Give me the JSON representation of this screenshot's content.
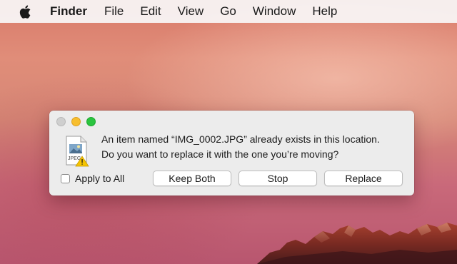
{
  "menubar": {
    "app_name": "Finder",
    "items": [
      "File",
      "Edit",
      "View",
      "Go",
      "Window",
      "Help"
    ]
  },
  "dialog": {
    "file_badge": "JPEG",
    "message_line1": "An item named “IMG_0002.JPG” already exists in this location.",
    "message_line2": "Do you want to replace it with the one you’re moving?",
    "checkbox_label": "Apply to All",
    "checkbox_checked": false,
    "buttons": {
      "keep_both": "Keep Both",
      "stop": "Stop",
      "replace": "Replace"
    }
  },
  "colors": {
    "close_light": "#cfcfcf",
    "minimize_light": "#f7be2e",
    "zoom_light": "#2ac43f",
    "warning": "#f5c400"
  },
  "icons": {
    "apple": "apple-logo-icon",
    "file": "jpeg-file-icon",
    "warning": "warning-triangle-icon"
  }
}
